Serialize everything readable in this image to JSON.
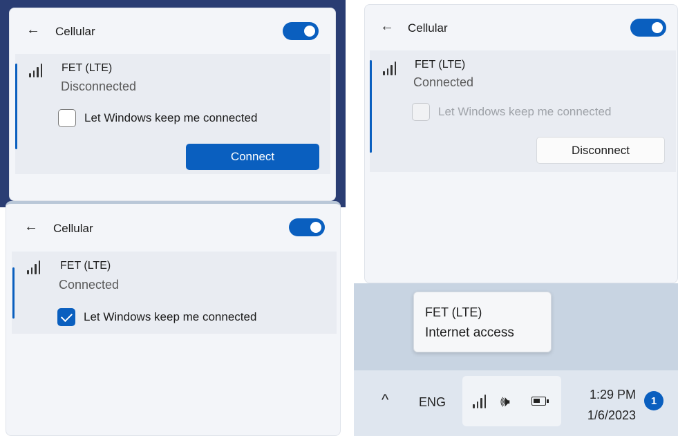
{
  "panels": [
    {
      "title": "Cellular",
      "back_glyph": "←",
      "toggle_on": true,
      "network_name": "FET (LTE)",
      "status": "Disconnected",
      "checkbox_label": "Let Windows keep me connected",
      "checkbox_checked": false,
      "checkbox_enabled": true,
      "button_label": "Connect"
    },
    {
      "title": "Cellular",
      "back_glyph": "←",
      "toggle_on": true,
      "network_name": "FET (LTE)",
      "status": "Connected",
      "checkbox_label": "Let Windows keep me connected",
      "checkbox_checked": false,
      "checkbox_enabled": false,
      "button_label": "Disconnect"
    },
    {
      "title": "Cellular",
      "back_glyph": "←",
      "toggle_on": true,
      "network_name": "FET (LTE)",
      "status": "Connected",
      "checkbox_label": "Let Windows keep me connected",
      "checkbox_checked": true,
      "checkbox_enabled": true
    }
  ],
  "tooltip": {
    "line1": "FET (LTE)",
    "line2": "Internet access"
  },
  "taskbar": {
    "chevron_glyph": "^",
    "language": "ENG",
    "volume_glyph": "🕪",
    "time": "1:29 PM",
    "date": "1/6/2023",
    "notification_count": "1"
  },
  "colors": {
    "accent": "#0a5fbf",
    "panel_bg": "#f3f5f9",
    "card_bg": "#e9ecf2"
  }
}
